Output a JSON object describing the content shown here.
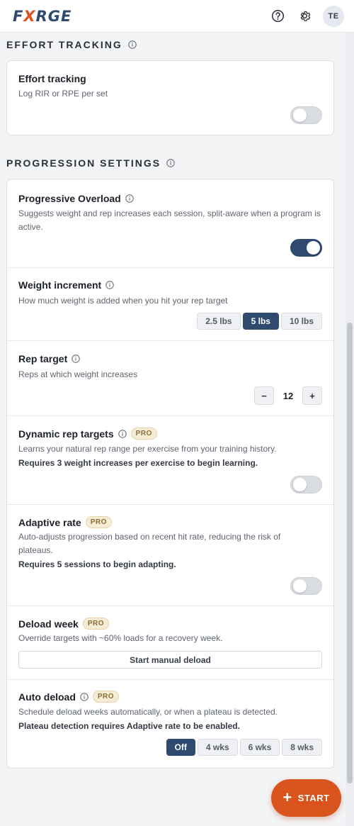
{
  "header": {
    "logo": {
      "left": "F",
      "mark": "X",
      "right": "RGE"
    },
    "help_icon": "help-circle-icon",
    "settings_icon": "gear-icon",
    "avatar_initials": "TE"
  },
  "effort_section": {
    "title": "EFFORT TRACKING",
    "rows": [
      {
        "title": "Effort tracking",
        "desc": "Log RIR or RPE per set",
        "enabled": false
      }
    ]
  },
  "progression_section": {
    "title": "PROGRESSION SETTINGS",
    "progressive_overload": {
      "title": "Progressive Overload",
      "desc": "Suggests weight and rep increases each session, split-aware when a program is active.",
      "enabled": true
    },
    "weight_increment": {
      "title": "Weight increment",
      "desc": "How much weight is added when you hit your rep target",
      "options": [
        "2.5 lbs",
        "5 lbs",
        "10 lbs"
      ],
      "selected": "5 lbs"
    },
    "rep_target": {
      "title": "Rep target",
      "desc": "Reps at which weight increases",
      "minus": "−",
      "value": "12",
      "plus": "+"
    },
    "dynamic_rep_targets": {
      "title": "Dynamic rep targets",
      "badge": "PRO",
      "desc": "Learns your natural rep range per exercise from your training history.",
      "requirement": "Requires 3 weight increases per exercise to begin learning.",
      "enabled": false
    },
    "adaptive_rate": {
      "title": "Adaptive rate",
      "badge": "PRO",
      "desc": "Auto-adjusts progression based on recent hit rate, reducing the risk of plateaus.",
      "requirement": "Requires 5 sessions to begin adapting.",
      "enabled": false
    },
    "deload_week": {
      "title": "Deload week",
      "badge": "PRO",
      "desc": "Override targets with ~60% loads for a recovery week.",
      "button": "Start manual deload"
    },
    "auto_deload": {
      "title": "Auto deload",
      "badge": "PRO",
      "desc": "Schedule deload weeks automatically, or when a plateau is detected.",
      "requirement": "Plateau detection requires Adaptive rate to be enabled.",
      "options": [
        "Off",
        "4 wks",
        "6 wks",
        "8 wks"
      ],
      "selected": "Off"
    }
  },
  "fab": {
    "label": "START",
    "icon": "plus-icon"
  },
  "colors": {
    "accent": "#d9541c",
    "primary": "#2e4a6e"
  }
}
